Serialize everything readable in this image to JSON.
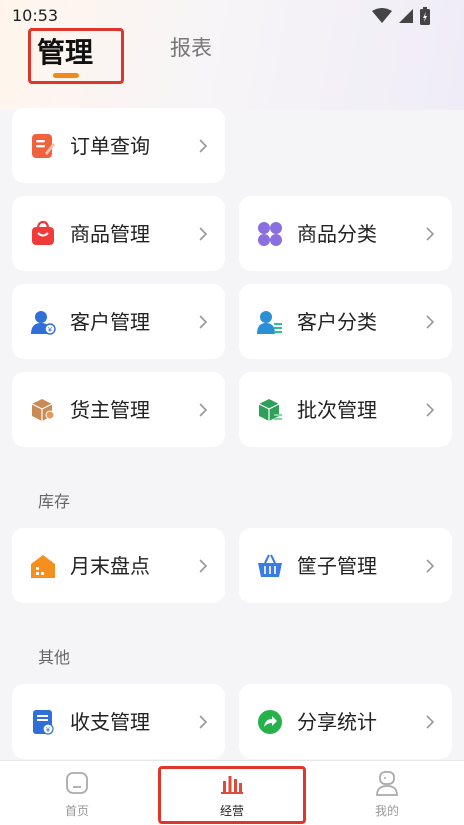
{
  "status_bar": {
    "time": "10:53"
  },
  "tabs": {
    "active": "管理",
    "inactive": "报表"
  },
  "management": {
    "orders": "订单查询",
    "product_mgmt": "商品管理",
    "product_category": "商品分类",
    "customer_mgmt": "客户管理",
    "customer_category": "客户分类",
    "owner_mgmt": "货主管理",
    "batch_mgmt": "批次管理"
  },
  "inventory": {
    "title": "库存",
    "month_end": "月末盘点",
    "basket_mgmt": "筐子管理"
  },
  "other": {
    "title": "其他",
    "income_expense": "收支管理",
    "share_stats": "分享统计"
  },
  "bottom_nav": {
    "home": "首页",
    "business": "经营",
    "mine": "我的"
  },
  "colors": {
    "accent": "#f08a1c",
    "highlight_box": "#e0352b",
    "nav_active": "#e04a3a"
  }
}
